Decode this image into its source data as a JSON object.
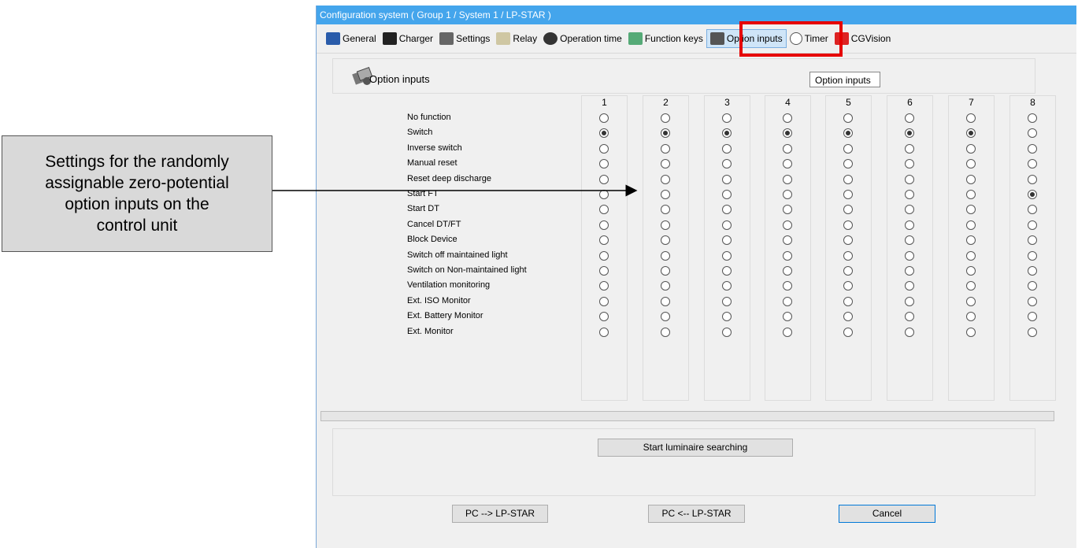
{
  "callout": {
    "line1": "Settings for the randomly",
    "line2": "assignable zero-potential",
    "line3": "option inputs on the",
    "line4": "control unit"
  },
  "window": {
    "title": "Configuration system ( Group 1 / System 1 / LP-STAR )"
  },
  "toolbar": {
    "items": [
      {
        "label": "General",
        "icon": "general-icon"
      },
      {
        "label": "Charger",
        "icon": "charger-icon"
      },
      {
        "label": "Settings",
        "icon": "settings-icon"
      },
      {
        "label": "Relay",
        "icon": "relay-icon"
      },
      {
        "label": "Operation time",
        "icon": "operation-time-icon"
      },
      {
        "label": "Function keys",
        "icon": "function-keys-icon"
      },
      {
        "label": "Option inputs",
        "icon": "option-inputs-icon",
        "active": true
      },
      {
        "label": "Timer",
        "icon": "timer-icon"
      },
      {
        "label": "CGVision",
        "icon": "cgvision-icon"
      }
    ],
    "tooltip": "Option inputs"
  },
  "panel": {
    "title": "Option inputs"
  },
  "inputs": {
    "columns": [
      "1",
      "2",
      "3",
      "4",
      "5",
      "6",
      "7",
      "8"
    ],
    "rows": [
      "No function",
      "Switch",
      "Inverse switch",
      "Manual reset",
      "Reset deep discharge",
      "Start FT",
      "Start DT",
      "Cancel DT/FT",
      "Block Device",
      "Switch off maintained light",
      "Switch on Non-maintained light",
      "Ventilation monitoring",
      "Ext. ISO Monitor",
      "Ext. Battery Monitor",
      "Ext. Monitor"
    ],
    "selected_row_index_per_column": [
      1,
      1,
      1,
      1,
      1,
      1,
      1,
      5
    ]
  },
  "buttons": {
    "search": "Start luminaire searching",
    "pc_to_lp": "PC --> LP-STAR",
    "lp_to_pc": "PC <-- LP-STAR",
    "cancel": "Cancel"
  },
  "colors": {
    "titlebar": "#44a5ec",
    "highlight_box": "#e60000"
  }
}
